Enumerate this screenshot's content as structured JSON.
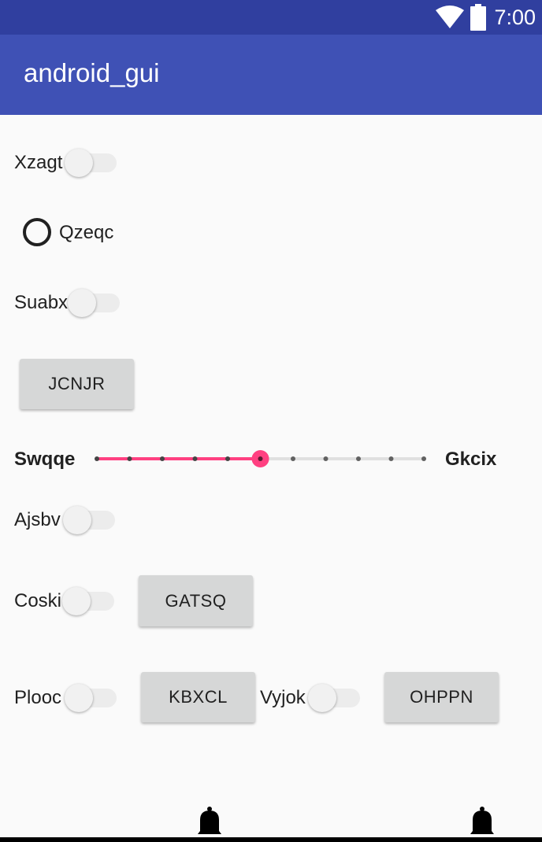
{
  "status_bar": {
    "time": "7:00",
    "wifi_icon": "wifi-icon",
    "battery_icon": "battery-icon"
  },
  "app_bar": {
    "title": "android_gui"
  },
  "widgets": {
    "switch_xzagt": {
      "label": "Xzagt",
      "checked": false
    },
    "radio_qzeqc": {
      "label": "Qzeqc",
      "checked": false
    },
    "switch_suabx": {
      "label": "Suabx",
      "checked": false
    },
    "button_jcnjr": {
      "label": "JCNJR"
    },
    "seekbar": {
      "left_label": "Swqqe",
      "right_label": "Gkcix",
      "value": 5,
      "max": 10,
      "color": "#ff4081"
    },
    "switch_ajsbv": {
      "label": "Ajsbv",
      "checked": false
    },
    "switch_coski": {
      "label": "Coski",
      "checked": false
    },
    "button_gatsq": {
      "label": "GATSQ"
    },
    "switch_plooc": {
      "label": "Plooc",
      "checked": false
    },
    "button_kbxcl": {
      "label": "KBXCL"
    },
    "switch_vyjok": {
      "label": "Vyjok",
      "checked": false
    },
    "button_ohppn": {
      "label": "OHPPN"
    }
  },
  "bottom": {
    "icons": [
      "bell-icon",
      "bell-icon"
    ]
  },
  "colors": {
    "status_bar": "#303f9f",
    "app_bar": "#3f51b5",
    "accent": "#ff4081"
  }
}
